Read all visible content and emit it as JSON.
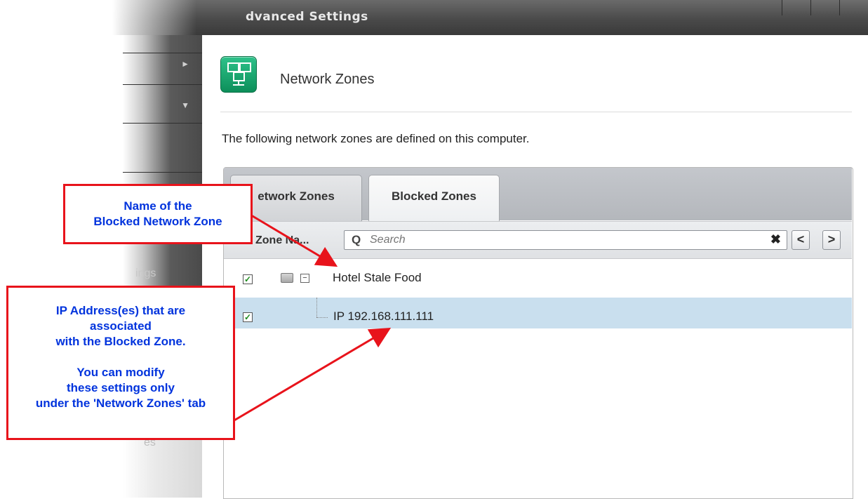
{
  "window": {
    "title": "dvanced Settings"
  },
  "sidebar": {
    "arrow_right": "►",
    "arrow_down": "▼",
    "partial_text_1": "ings",
    "partial_text_2": "es"
  },
  "header": {
    "title": "Network Zones"
  },
  "description": "The following network zones are defined on this computer.",
  "tabs": [
    {
      "label": "etwork Zones",
      "active": false
    },
    {
      "label": "Blocked Zones",
      "active": true
    }
  ],
  "toolbar": {
    "column_header": "Zone Na...",
    "search_placeholder": "Search",
    "clear_symbol": "✖",
    "prev_symbol": "<",
    "next_symbol": ">"
  },
  "zones": [
    {
      "name": "Hotel Stale Food",
      "checked": true,
      "ip": "IP 192.168.111.111",
      "ip_checked": true
    }
  ],
  "callouts": {
    "zone_name": [
      "Name of the",
      "Blocked Network Zone"
    ],
    "ip_address": [
      "IP Address(es) that are",
      "associated",
      "with the Blocked Zone.",
      "",
      "You can modify",
      "these settings only",
      "under the 'Network Zones' tab"
    ]
  },
  "colors": {
    "accent_red": "#e8131b",
    "callout_text": "#0033dd",
    "row_selected": "#c9dfee"
  }
}
